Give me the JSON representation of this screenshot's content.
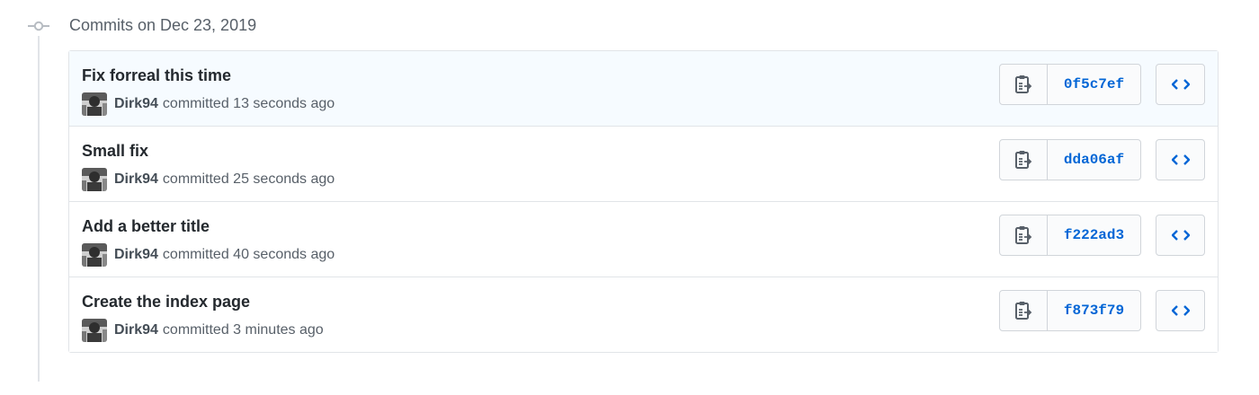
{
  "group": {
    "title": "Commits on Dec 23, 2019"
  },
  "commits": [
    {
      "title": "Fix forreal this time",
      "author": "Dirk94",
      "action": "committed",
      "time": "13 seconds ago",
      "sha": "0f5c7ef"
    },
    {
      "title": "Small fix",
      "author": "Dirk94",
      "action": "committed",
      "time": "25 seconds ago",
      "sha": "dda06af"
    },
    {
      "title": "Add a better title",
      "author": "Dirk94",
      "action": "committed",
      "time": "40 seconds ago",
      "sha": "f222ad3"
    },
    {
      "title": "Create the index page",
      "author": "Dirk94",
      "action": "committed",
      "time": "3 minutes ago",
      "sha": "f873f79"
    }
  ],
  "icons": {
    "timeline": "git-commit-icon",
    "copy": "clipboard-icon",
    "browse": "code-icon",
    "avatar": "avatar"
  },
  "colors": {
    "link": "#0366d6",
    "highlight_row": "#f6fbff",
    "border": "#e1e4e8"
  }
}
